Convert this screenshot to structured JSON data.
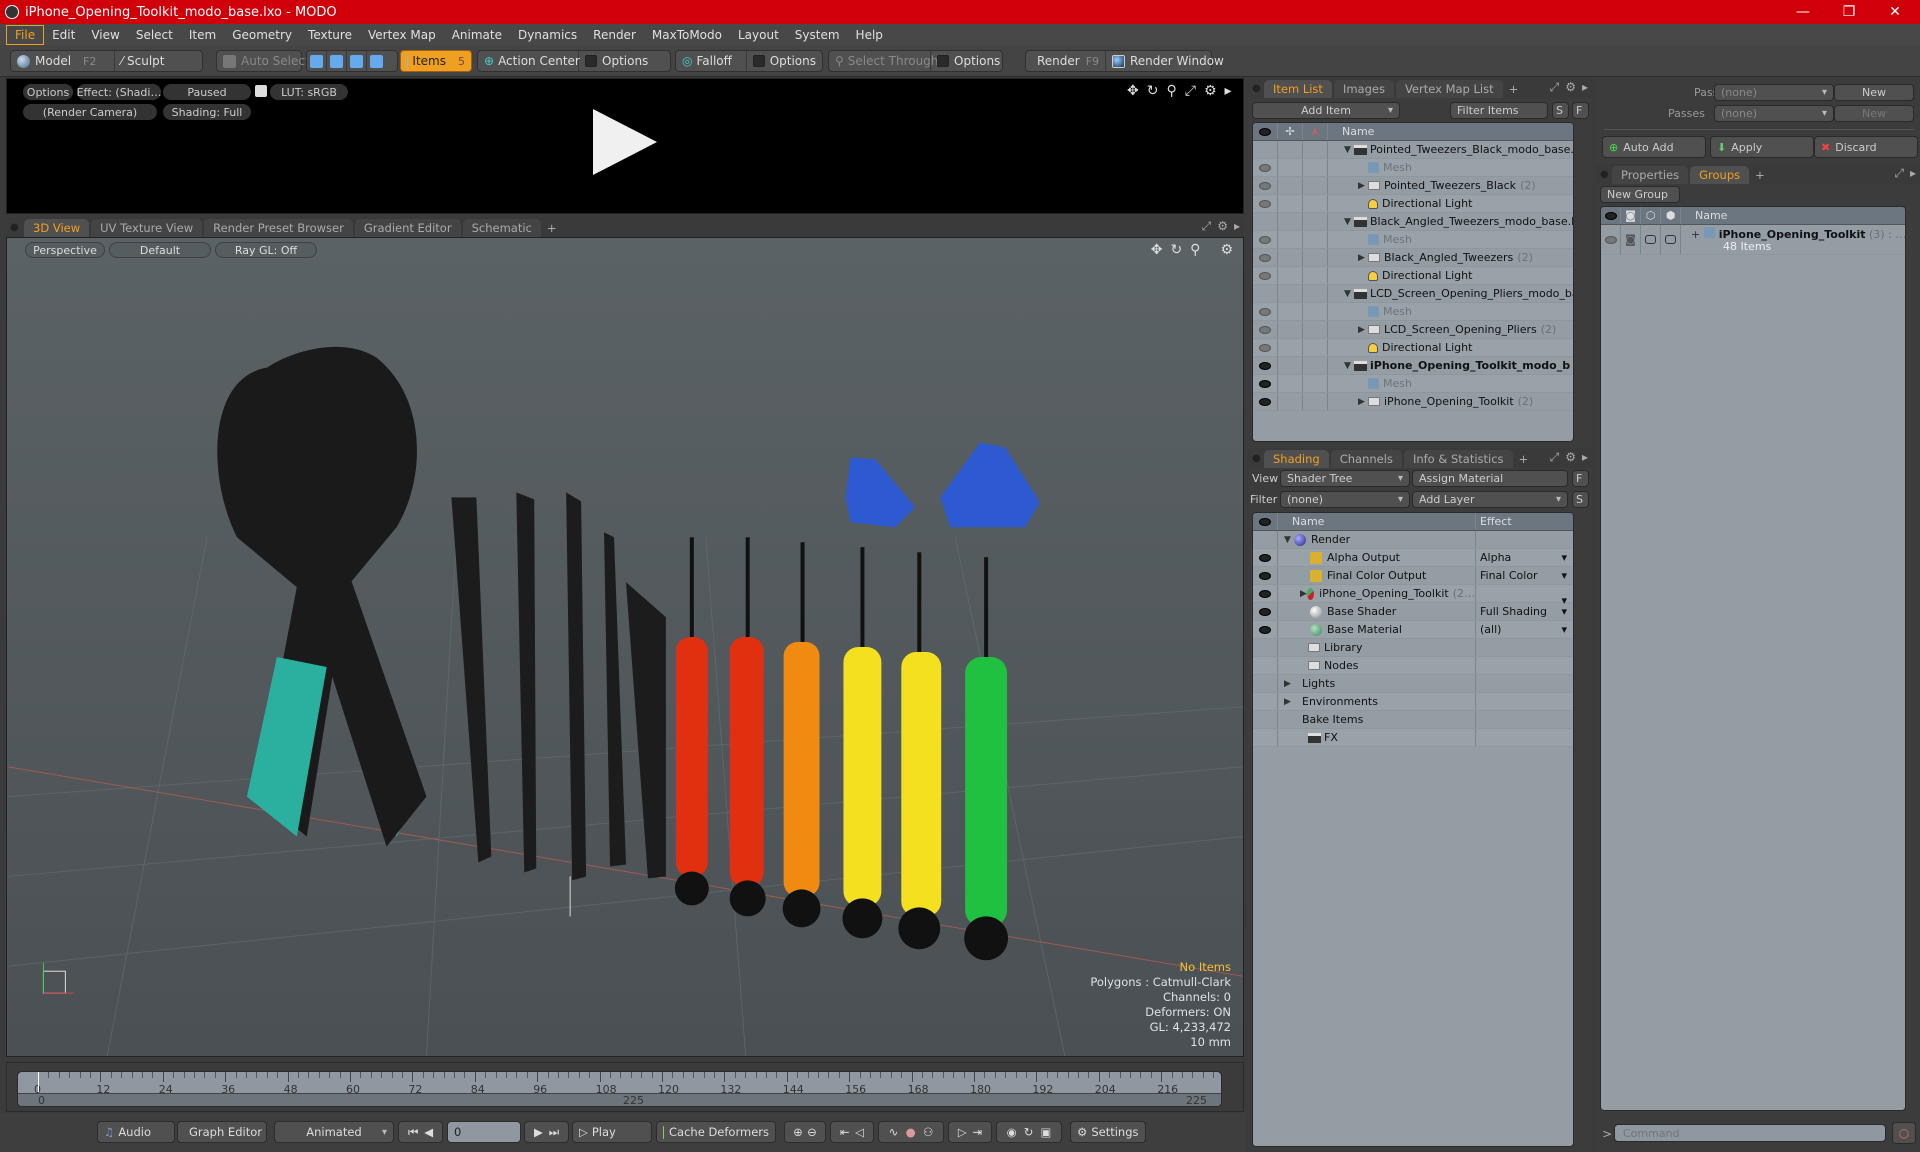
{
  "window": {
    "title": "iPhone_Opening_Toolkit_modo_base.lxo - MODO",
    "controls": [
      "minimize",
      "restore",
      "close"
    ]
  },
  "menu": [
    "File",
    "Edit",
    "View",
    "Select",
    "Item",
    "Geometry",
    "Texture",
    "Vertex Map",
    "Animate",
    "Dynamics",
    "Render",
    "MaxToModo",
    "Layout",
    "System",
    "Help"
  ],
  "toolbar": {
    "model": "Model",
    "model_key": "F2",
    "sculpt": "Sculpt",
    "auto_select": "Auto Select",
    "items": "Items",
    "items_key": "5",
    "action_center": "Action Center",
    "options1": "Options",
    "falloff": "Falloff",
    "options2": "Options",
    "select_through": "Select Through",
    "options3": "Options",
    "render": "Render",
    "render_key": "F9",
    "render_window": "Render Window"
  },
  "render_preview": {
    "options": "Options",
    "effect": "Effect: (Shadi…",
    "status": "Paused",
    "lut": "LUT: sRGB",
    "camera": "(Render Camera)",
    "shading": "Shading: Full"
  },
  "viewport_tabs": [
    "3D View",
    "UV Texture View",
    "Render Preset Browser",
    "Gradient Editor",
    "Schematic"
  ],
  "viewport": {
    "projection": "Perspective",
    "style": "Default",
    "raygl": "Ray GL: Off",
    "hud": {
      "selection": "No Items",
      "polygons": "Polygons : Catmull-Clark",
      "channels": "Channels: 0",
      "deformers": "Deformers: ON",
      "gl": "GL: 4,233,472",
      "scale": "10 mm"
    }
  },
  "item_list": {
    "tabs": [
      "Item List",
      "Images",
      "Vertex Map List"
    ],
    "add_item": "Add Item",
    "filter": "Filter Items",
    "s_btn": "S",
    "f_btn": "F",
    "header": "Name",
    "rows": [
      {
        "name": "Pointed_Tweezers_Black_modo_base.lxo",
        "type": "scene",
        "level": 0,
        "eye": false
      },
      {
        "name": "Mesh",
        "type": "mesh",
        "level": 1,
        "eye": true,
        "dim": true
      },
      {
        "name": "Pointed_Tweezers_Black",
        "count": "(2)",
        "type": "group",
        "level": 1,
        "eye": true
      },
      {
        "name": "Directional Light",
        "type": "light",
        "level": 1,
        "eye": true
      },
      {
        "name": "Black_Angled_Tweezers_modo_base.lxo",
        "type": "scene",
        "level": 0,
        "eye": false
      },
      {
        "name": "Mesh",
        "type": "mesh",
        "level": 1,
        "eye": true,
        "dim": true
      },
      {
        "name": "Black_Angled_Tweezers",
        "count": "(2)",
        "type": "group",
        "level": 1,
        "eye": true
      },
      {
        "name": "Directional Light",
        "type": "light",
        "level": 1,
        "eye": true
      },
      {
        "name": "LCD_Screen_Opening_Pliers_modo_bas …",
        "type": "scene",
        "level": 0,
        "eye": false
      },
      {
        "name": "Mesh",
        "type": "mesh",
        "level": 1,
        "eye": true,
        "dim": true
      },
      {
        "name": "LCD_Screen_Opening_Pliers",
        "count": "(2)",
        "type": "group",
        "level": 1,
        "eye": true
      },
      {
        "name": "Directional Light",
        "type": "light",
        "level": 1,
        "eye": true
      },
      {
        "name": "iPhone_Opening_Toolkit_modo_b …",
        "type": "scene",
        "level": 0,
        "eye": true,
        "bold": true
      },
      {
        "name": "Mesh",
        "type": "mesh",
        "level": 1,
        "eye": true,
        "dim": true
      },
      {
        "name": "iPhone_Opening_Toolkit",
        "count": "(2)",
        "type": "group",
        "level": 1,
        "eye": true
      }
    ]
  },
  "shading": {
    "tabs": [
      "Shading",
      "Channels",
      "Info & Statistics"
    ],
    "view_label": "View",
    "view_value": "Shader Tree",
    "assign_material": "Assign Material",
    "f_btn": "F",
    "filter_label": "Filter",
    "filter_value": "(none)",
    "add_layer": "Add Layer",
    "s_btn": "S",
    "headers": [
      "Name",
      "Effect"
    ],
    "rows": [
      {
        "name": "Render",
        "effect": "",
        "icon": "render-sphere",
        "level": 0,
        "eye": false
      },
      {
        "name": "Alpha Output",
        "effect": "Alpha",
        "icon": "output",
        "level": 1,
        "eye": true
      },
      {
        "name": "Final Color Output",
        "effect": "Final Color",
        "icon": "output",
        "level": 1,
        "eye": true
      },
      {
        "name": "iPhone_Opening_Toolkit",
        "count": "(2…",
        "effect": "",
        "icon": "material-group",
        "level": 1,
        "eye": true
      },
      {
        "name": "Base Shader",
        "effect": "Full Shading",
        "icon": "shader",
        "level": 1,
        "eye": true
      },
      {
        "name": "Base Material",
        "effect": "(all)",
        "icon": "material",
        "level": 1,
        "eye": true
      },
      {
        "name": "Library",
        "effect": "",
        "icon": "folder",
        "level": 1,
        "eye": false
      },
      {
        "name": "Nodes",
        "effect": "",
        "icon": "folder",
        "level": 1,
        "eye": false
      },
      {
        "name": "Lights",
        "effect": "",
        "icon": "none",
        "level": 0,
        "eye": false
      },
      {
        "name": "Environments",
        "effect": "",
        "icon": "none",
        "level": 0,
        "eye": false
      },
      {
        "name": "Bake Items",
        "effect": "",
        "icon": "none",
        "level": 0,
        "eye": false
      },
      {
        "name": "FX",
        "effect": "",
        "icon": "scene",
        "level": 1,
        "eye": false
      }
    ]
  },
  "passes": {
    "pass_groups_label": "Pass Groups",
    "pass_groups_value": "(none)",
    "new1": "New",
    "passes_label": "Passes",
    "passes_value": "(none)",
    "new2": "New",
    "auto_add": "Auto Add",
    "apply": "Apply",
    "discard": "Discard"
  },
  "groups": {
    "tabs": [
      "Properties",
      "Groups"
    ],
    "new_group": "New Group",
    "header": "Name",
    "items": [
      {
        "name": "iPhone_Opening_Toolkit",
        "count": "(3) : …",
        "sub": "48 Items"
      }
    ]
  },
  "timeline": {
    "ticks": [
      "0",
      "12",
      "24",
      "36",
      "48",
      "60",
      "72",
      "84",
      "96",
      "108",
      "120",
      "132",
      "144",
      "156",
      "168",
      "180",
      "192",
      "204",
      "216"
    ],
    "start": "0",
    "mid": "225",
    "end": "225"
  },
  "transport": {
    "audio": "Audio",
    "graph_editor": "Graph Editor",
    "mode": "Animated",
    "frame": "0",
    "play": "Play",
    "cache_deformers": "Cache Deformers",
    "settings": "Settings"
  },
  "command": {
    "prompt": ">",
    "placeholder": "Command"
  }
}
